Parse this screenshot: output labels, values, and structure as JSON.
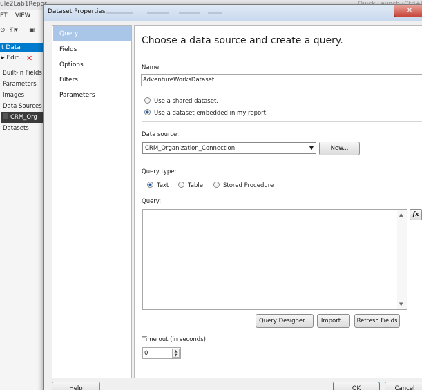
{
  "ide": {
    "title_fragment": "ule2Lab1Repor",
    "quick_launch": "Quick Launch (Ctrl+Q)",
    "menu": [
      "ET",
      "VIEW"
    ],
    "report_data_header": "t Data",
    "edit_label": "Edit...",
    "tree_items": [
      "Built-in Fields",
      "Parameters",
      "Images",
      "Data Sources",
      "CRM_Org",
      "Datasets"
    ]
  },
  "dialog": {
    "title": "Dataset Properties",
    "close_glyph": "✕",
    "nav": [
      "Query",
      "Fields",
      "Options",
      "Filters",
      "Parameters"
    ],
    "heading": "Choose a data source and create a query.",
    "name_label": "Name:",
    "name_value": "AdventureWorksDataset",
    "radio_shared": "Use a shared dataset.",
    "radio_embedded": "Use a dataset embedded in my report.",
    "data_source_label": "Data source:",
    "data_source_value": "CRM_Organization_Connection",
    "new_button": "New...",
    "query_type_label": "Query type:",
    "query_type_options": [
      "Text",
      "Table",
      "Stored Procedure"
    ],
    "query_type_selected": "Text",
    "query_label": "Query:",
    "query_text": "",
    "fx_button": "fx",
    "query_designer_button": "Query Designer...",
    "import_button": "Import...",
    "refresh_fields_button": "Refresh Fields",
    "timeout_label": "Time out (in seconds):",
    "timeout_value": "0",
    "help_button": "Help",
    "ok_button": "OK",
    "cancel_button": "Cancel"
  }
}
